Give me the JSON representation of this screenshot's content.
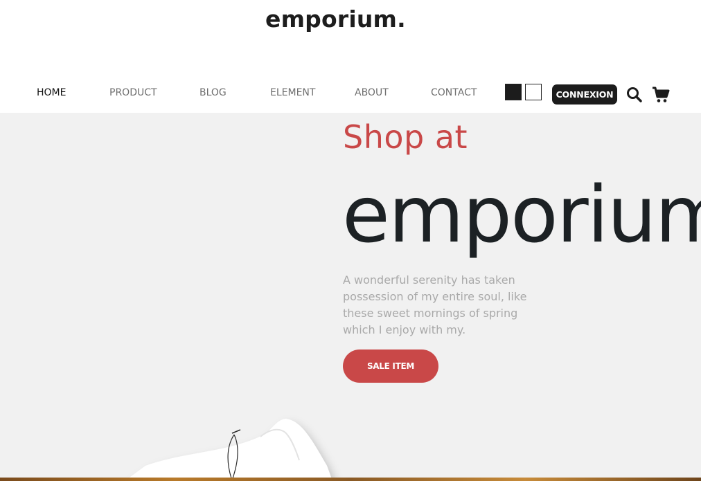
{
  "header": {
    "logo": "emporium.",
    "nav": [
      {
        "label": "HOME",
        "active": true
      },
      {
        "label": "PRODUCT",
        "active": false
      },
      {
        "label": "BLOG",
        "active": false
      },
      {
        "label": "ELEMENT",
        "active": false
      },
      {
        "label": "ABOUT",
        "active": false
      },
      {
        "label": "CONTACT",
        "active": false
      }
    ],
    "theme_swatches": [
      {
        "name": "dark",
        "color": "#1c1c1c"
      },
      {
        "name": "light",
        "color": "#ffffff"
      }
    ],
    "connexion_label": "CONNEXION",
    "icons": [
      "search-icon",
      "cart-icon"
    ]
  },
  "hero": {
    "kicker": "Shop at",
    "title": "emporium",
    "description": "A wonderful serenity has taken possession of my entire soul, like these sweet mornings of spring which I enjoy with my.",
    "button_label": "SALE ITEM",
    "image": "white-tshirt"
  },
  "colors": {
    "accent": "#c94848",
    "dark": "#1c1c1c",
    "hero_background": "#f1f1f1",
    "muted_text": "#a9a9a9"
  }
}
